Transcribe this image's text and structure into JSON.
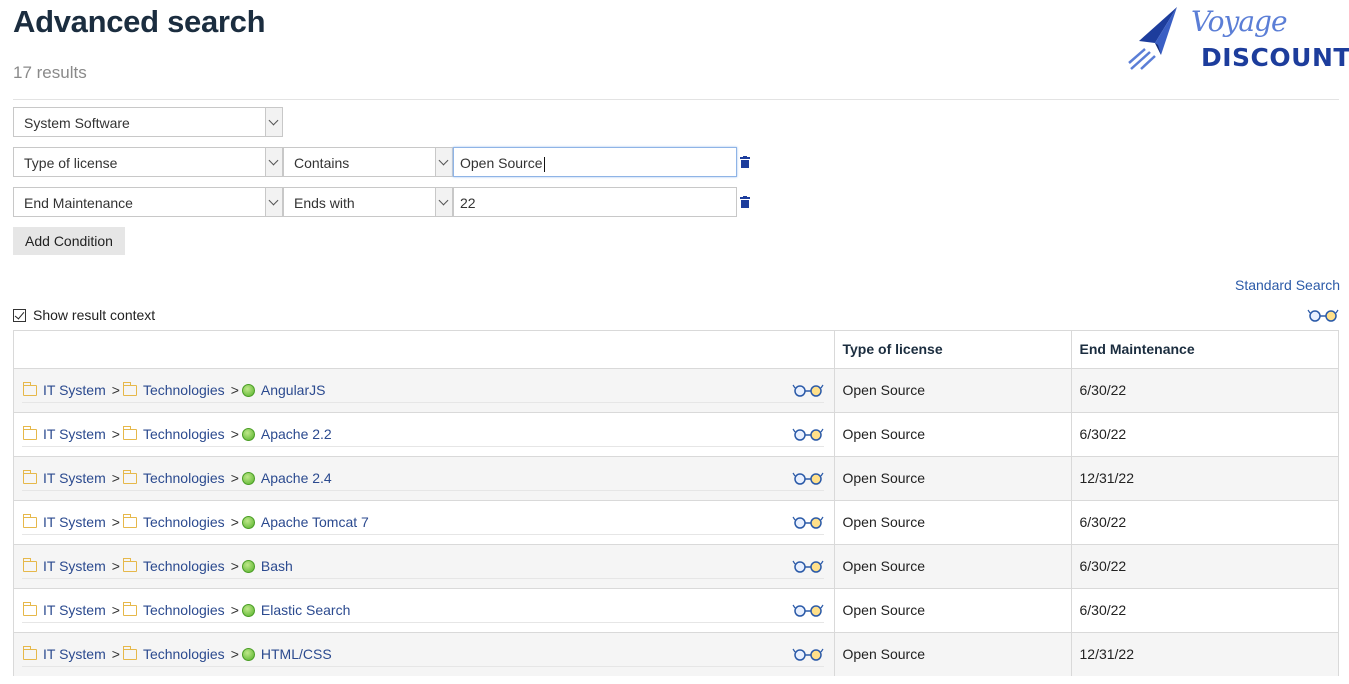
{
  "page": {
    "title": "Advanced search",
    "result_count": "17 results"
  },
  "logo": {
    "script_text": "Voyage",
    "word_text": "DISCOUNT"
  },
  "filters": {
    "category": {
      "value": "System Software"
    },
    "conditions": [
      {
        "field": "Type of license",
        "operator": "Contains",
        "value": "Open Source"
      },
      {
        "field": "End Maintenance",
        "operator": "Ends with",
        "value": "22"
      }
    ],
    "add_condition_label": "Add Condition"
  },
  "standard_search_label": "Standard Search",
  "show_context_label": "Show result context",
  "show_context_checked": true,
  "table": {
    "headers": [
      "",
      "Type of license",
      "End Maintenance"
    ],
    "rows": [
      {
        "p1": "IT System",
        "p2": "Technologies",
        "name": "AngularJS",
        "license": "Open Source",
        "end": "6/30/22"
      },
      {
        "p1": "IT System",
        "p2": "Technologies",
        "name": "Apache 2.2",
        "license": "Open Source",
        "end": "6/30/22"
      },
      {
        "p1": "IT System",
        "p2": "Technologies",
        "name": "Apache 2.4",
        "license": "Open Source",
        "end": "12/31/22"
      },
      {
        "p1": "IT System",
        "p2": "Technologies",
        "name": "Apache Tomcat 7",
        "license": "Open Source",
        "end": "6/30/22"
      },
      {
        "p1": "IT System",
        "p2": "Technologies",
        "name": "Bash",
        "license": "Open Source",
        "end": "6/30/22"
      },
      {
        "p1": "IT System",
        "p2": "Technologies",
        "name": "Elastic Search",
        "license": "Open Source",
        "end": "6/30/22"
      },
      {
        "p1": "IT System",
        "p2": "Technologies",
        "name": "HTML/CSS",
        "license": "Open Source",
        "end": "12/31/22"
      }
    ]
  },
  "colors": {
    "title": "#1b2d3f",
    "link": "#2b4a8f",
    "brand": "#1d3d9c",
    "brand_light": "#5b7ed6",
    "folder": "#e6b84a",
    "item_dot": "#55b22a"
  }
}
